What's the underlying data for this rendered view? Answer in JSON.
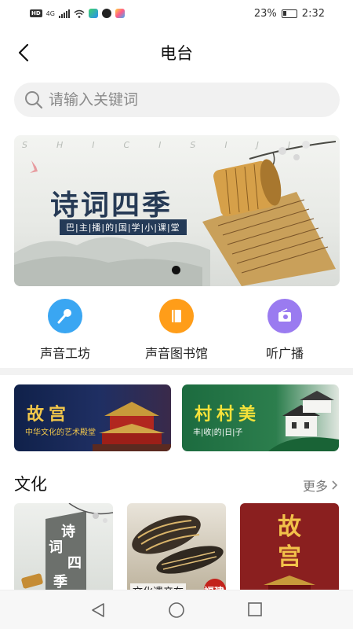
{
  "status": {
    "net_chip": "HD",
    "signal_label": "4G",
    "battery": "23%",
    "time": "2:32"
  },
  "header": {
    "title": "电台"
  },
  "search": {
    "placeholder": "请输入关键词"
  },
  "banner": {
    "title": "诗词四季",
    "subtitle": "巴|主|播|的|国|学|小|课|堂",
    "letters": "SHICISIJI"
  },
  "features": [
    {
      "label": "声音工坊",
      "icon": "microphone-icon",
      "color": "#3aa6f2"
    },
    {
      "label": "声音图书馆",
      "icon": "book-icon",
      "color": "#ff9d19"
    },
    {
      "label": "听广播",
      "icon": "radio-icon",
      "color": "#9a7bf0"
    }
  ],
  "cards": [
    {
      "title": "故宫",
      "subtitle": "中华文化的艺术殿堂"
    },
    {
      "title": "村村美",
      "subtitle": "丰|收|的|日|子"
    }
  ],
  "section": {
    "title": "文化",
    "more_label": "更多"
  },
  "thumbs": [
    {
      "text1": "诗",
      "text2": "词",
      "text3": "四",
      "text4": "季"
    },
    {
      "caption": "文化遗产在",
      "badge": "福建"
    },
    {
      "title": "故宫"
    }
  ],
  "colors": {
    "accent_blue": "#3aa6f2",
    "accent_orange": "#ff9d19",
    "accent_purple": "#9a7bf0",
    "navy": "#263a55"
  }
}
